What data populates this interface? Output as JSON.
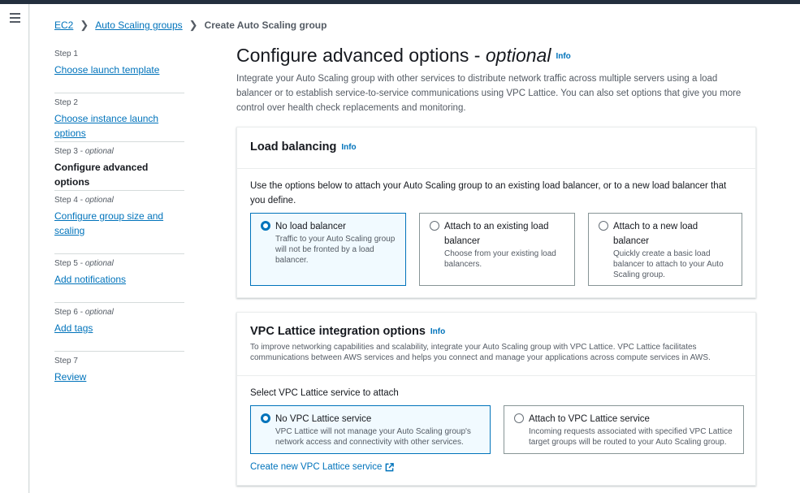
{
  "breadcrumb": {
    "items": [
      "EC2",
      "Auto Scaling groups"
    ],
    "current": "Create Auto Scaling group"
  },
  "steps": [
    {
      "num": "Step 1",
      "optional": "",
      "label": "Choose launch template"
    },
    {
      "num": "Step 2",
      "optional": "",
      "label": "Choose instance launch options"
    },
    {
      "num": "Step 3 - ",
      "optional": "optional",
      "label": "Configure advanced options"
    },
    {
      "num": "Step 4 - ",
      "optional": "optional",
      "label": "Configure group size and scaling"
    },
    {
      "num": "Step 5 - ",
      "optional": "optional",
      "label": "Add notifications"
    },
    {
      "num": "Step 6 - ",
      "optional": "optional",
      "label": "Add tags"
    },
    {
      "num": "Step 7",
      "optional": "",
      "label": "Review"
    }
  ],
  "page": {
    "title": "Configure advanced options - ",
    "title_italic": "optional",
    "info": "Info",
    "description": "Integrate your Auto Scaling group with other services to distribute network traffic across multiple servers using a load balancer or to establish service-to-service communications using VPC Lattice. You can also set options that give you more control over health check replacements and monitoring."
  },
  "load_balancing": {
    "title": "Load balancing",
    "info": "Info",
    "instructions": "Use the options below to attach your Auto Scaling group to an existing load balancer, or to a new load balancer that you define.",
    "options": [
      {
        "label": "No load balancer",
        "desc": "Traffic to your Auto Scaling group will not be fronted by a load balancer.",
        "selected": true
      },
      {
        "label": "Attach to an existing load balancer",
        "desc": "Choose from your existing load balancers.",
        "selected": false
      },
      {
        "label": "Attach to a new load balancer",
        "desc": "Quickly create a basic load balancer to attach to your Auto Scaling group.",
        "selected": false
      }
    ]
  },
  "vpc_lattice": {
    "title": "VPC Lattice integration options",
    "info": "Info",
    "description": "To improve networking capabilities and scalability, integrate your Auto Scaling group with VPC Lattice. VPC Lattice facilitates communications between AWS services and helps you connect and manage your applications across compute services in AWS.",
    "select_label": "Select VPC Lattice service to attach",
    "options": [
      {
        "label": "No VPC Lattice service",
        "desc": "VPC Lattice will not manage your Auto Scaling group's network access and connectivity with other services.",
        "selected": true
      },
      {
        "label": "Attach to VPC Lattice service",
        "desc": "Incoming requests associated with specified VPC Lattice target groups will be routed to your Auto Scaling group.",
        "selected": false
      }
    ],
    "create_link": "Create new VPC Lattice service"
  },
  "colors": {
    "accent": "#0073bb",
    "selected_bg": "#f1faff",
    "topbar": "#232f3e"
  }
}
